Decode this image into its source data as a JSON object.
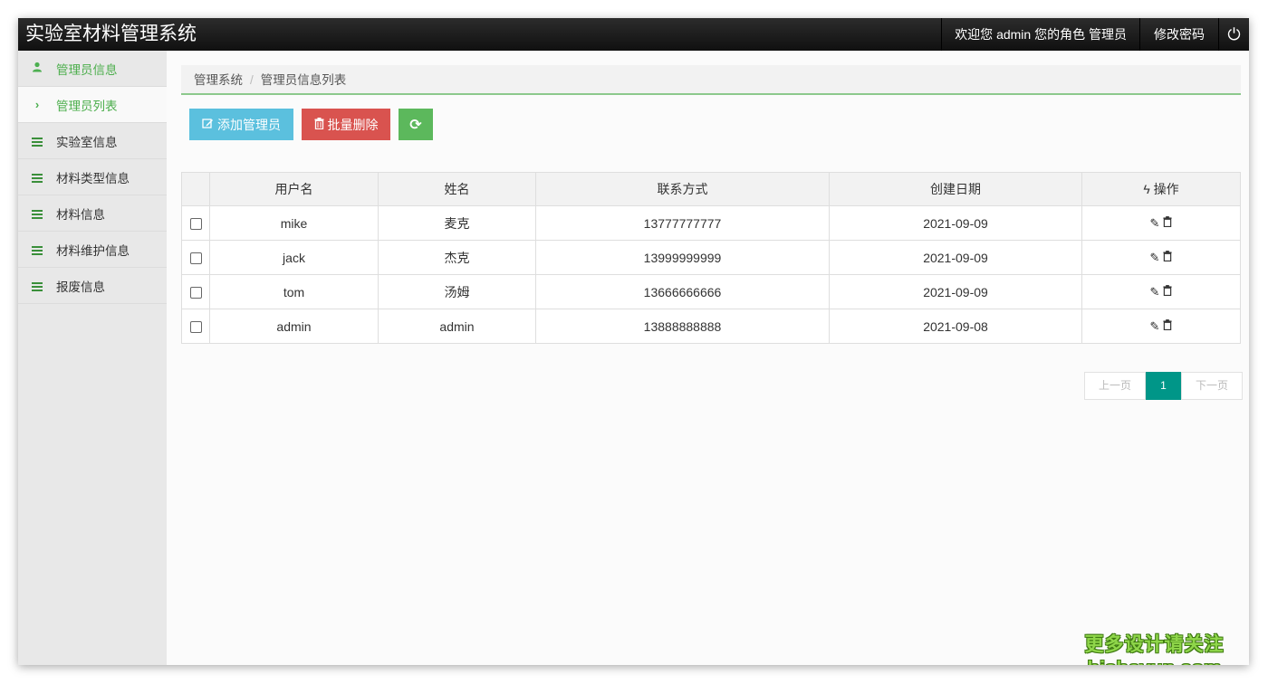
{
  "app": {
    "title": "实验室材料管理系统",
    "welcome": "欢迎您 admin 您的角色 管理员",
    "change_password": "修改密码",
    "power_icon": "⏻"
  },
  "sidebar": {
    "items": [
      {
        "label": "管理员信息",
        "icon": "user-icon"
      },
      {
        "label": "管理员列表",
        "icon": "chevron-right-icon"
      },
      {
        "label": "实验室信息",
        "icon": "menu-icon"
      },
      {
        "label": "材料类型信息",
        "icon": "menu-icon"
      },
      {
        "label": "材料信息",
        "icon": "menu-icon"
      },
      {
        "label": "材料维护信息",
        "icon": "menu-icon"
      },
      {
        "label": "报废信息",
        "icon": "menu-icon"
      }
    ]
  },
  "breadcrumb": {
    "root": "管理系统",
    "current": "管理员信息列表"
  },
  "toolbar": {
    "add_label": "添加管理员",
    "batch_delete_label": "批量删除",
    "refresh_icon": "refresh-icon"
  },
  "table": {
    "headers": [
      "用户名",
      "姓名",
      "联系方式",
      "创建日期",
      "操作"
    ],
    "rows": [
      {
        "username": "mike",
        "name": "麦克",
        "phone": "13777777777",
        "created": "2021-09-09"
      },
      {
        "username": "jack",
        "name": "杰克",
        "phone": "13999999999",
        "created": "2021-09-09"
      },
      {
        "username": "tom",
        "name": "汤姆",
        "phone": "13666666666",
        "created": "2021-09-09"
      },
      {
        "username": "admin",
        "name": "admin",
        "phone": "13888888888",
        "created": "2021-09-08"
      }
    ]
  },
  "pagination": {
    "prev": "上一页",
    "current": "1",
    "next": "下一页"
  },
  "watermark": {
    "line1": "更多设计请关注",
    "line2": "bisheyun.com"
  },
  "colors": {
    "accent_green": "#4caf50",
    "info": "#5bc0de",
    "danger": "#d9534f",
    "success": "#5cb85c",
    "pager_active": "#009688"
  }
}
